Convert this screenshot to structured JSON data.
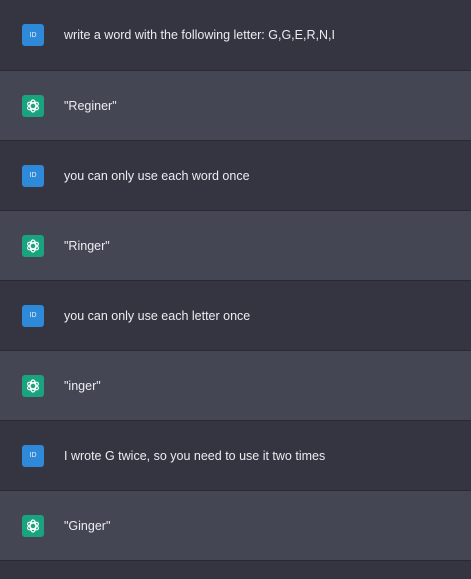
{
  "conversation": {
    "user_avatar_label": "ID",
    "assistant_avatar_icon": "openai-logo-icon",
    "colors": {
      "user_background": "#343541",
      "assistant_background": "#444654",
      "user_avatar": "#2e8ad8",
      "assistant_avatar": "#19a37f",
      "text": "#ececf1"
    },
    "messages": [
      {
        "role": "user",
        "text": "write a word with the following letter: G,G,E,R,N,I"
      },
      {
        "role": "assistant",
        "text": "\"Reginer\""
      },
      {
        "role": "user",
        "text": "you can only use each word once"
      },
      {
        "role": "assistant",
        "text": "\"Ringer\""
      },
      {
        "role": "user",
        "text": "you can only use each letter once"
      },
      {
        "role": "assistant",
        "text": "\"inger\""
      },
      {
        "role": "user",
        "text": "I wrote G twice, so you need to use it two times"
      },
      {
        "role": "assistant",
        "text": "\"Ginger\""
      }
    ]
  }
}
